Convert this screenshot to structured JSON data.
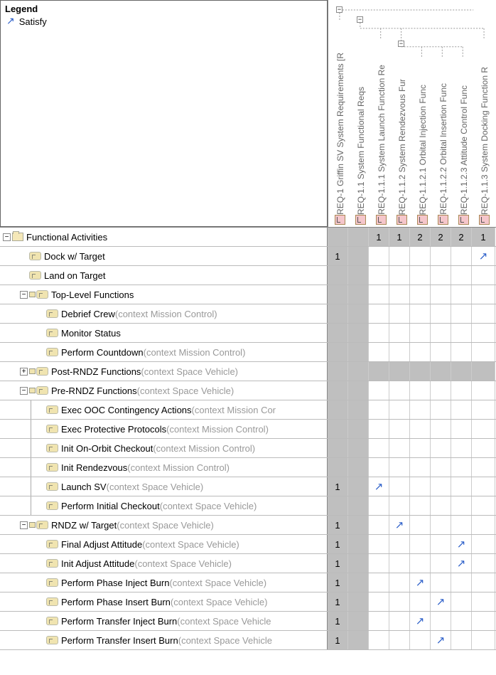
{
  "legend": {
    "title": "Legend",
    "items": [
      {
        "icon": "arrow-ne",
        "label": "Satisfy"
      }
    ]
  },
  "columns": [
    {
      "id": "REQ-1",
      "label": "REQ-1 Griffin SV System Requirements [R",
      "level": 0
    },
    {
      "id": "REQ-1.1",
      "label": "REQ-1.1 System Functional Reqs",
      "level": 1
    },
    {
      "id": "REQ-1.1.1",
      "label": "REQ-1.1.1 System Launch Function Re",
      "level": 2
    },
    {
      "id": "REQ-1.1.2",
      "label": "REQ-1.1.2 System Rendezvous Fur",
      "level": 2
    },
    {
      "id": "REQ-1.1.2.1",
      "label": "REQ-1.1.2.1 Orbital Injection Func",
      "level": 3
    },
    {
      "id": "REQ-1.1.2.2",
      "label": "REQ-1.1.2.2 Orbital Insertion Func",
      "level": 3
    },
    {
      "id": "REQ-1.1.2.3",
      "label": "REQ-1.1.2.3 Attitude Control Func",
      "level": 3
    },
    {
      "id": "REQ-1.1.3",
      "label": "REQ-1.1.3 System Docking Function R",
      "level": 2
    }
  ],
  "column_summary": [
    "",
    "",
    "1",
    "1",
    "2",
    "2",
    "2",
    "1"
  ],
  "rows": [
    {
      "type": "folder",
      "indent": 0,
      "toggle": "-",
      "label": "Functional Activities",
      "summary_row": true
    },
    {
      "type": "activity",
      "indent": 1,
      "label": "Dock w/ Target",
      "cells": {
        "0": "1",
        "7": "arrow"
      }
    },
    {
      "type": "activity",
      "indent": 1,
      "label": "Land on Target",
      "cells": {}
    },
    {
      "type": "activity",
      "indent": 1,
      "toggle": "-",
      "link": true,
      "label": "Top-Level Functions",
      "cells": {}
    },
    {
      "type": "activity",
      "indent": 2,
      "label": "Debrief Crew",
      "context": "(context Mission Control)",
      "cells": {}
    },
    {
      "type": "activity",
      "indent": 2,
      "label": "Monitor Status",
      "cells": {}
    },
    {
      "type": "activity",
      "indent": 2,
      "label": "Perform Countdown",
      "context": "(context Mission Control)",
      "cells": {}
    },
    {
      "type": "activity",
      "indent": 1,
      "toggle": "+",
      "link": true,
      "label": "Post-RNDZ Functions",
      "context": "(context Space Vehicle)",
      "all_grey": true
    },
    {
      "type": "activity",
      "indent": 1,
      "toggle": "-",
      "link": true,
      "label": "Pre-RNDZ Functions",
      "context": "(context Space Vehicle)",
      "cells": {}
    },
    {
      "type": "activity",
      "indent": 2,
      "vline_from": 1,
      "label": "Exec OOC Contingency Actions",
      "context": "(context Mission Cor",
      "cells": {}
    },
    {
      "type": "activity",
      "indent": 2,
      "vline_from": 1,
      "label": "Exec Protective Protocols",
      "context": "(context Mission Control)",
      "cells": {}
    },
    {
      "type": "activity",
      "indent": 2,
      "vline_from": 1,
      "label": "Init On-Orbit Checkout",
      "context": "(context Mission Control)",
      "cells": {}
    },
    {
      "type": "activity",
      "indent": 2,
      "vline_from": 1,
      "label": "Init Rendezvous",
      "context": "(context Mission Control)",
      "cells": {}
    },
    {
      "type": "activity",
      "indent": 2,
      "vline_from": 1,
      "label": "Launch SV",
      "context": "(context Space Vehicle)",
      "cells": {
        "0": "1",
        "2": "arrow"
      }
    },
    {
      "type": "activity",
      "indent": 2,
      "vline_from": 1,
      "last": true,
      "label": "Perform Initial Checkout",
      "context": "(context Space Vehicle)",
      "cells": {}
    },
    {
      "type": "activity",
      "indent": 1,
      "toggle": "-",
      "link": true,
      "label": "RNDZ w/ Target",
      "context": "(context Space Vehicle)",
      "cells": {
        "0": "1",
        "3": "arrow"
      }
    },
    {
      "type": "activity",
      "indent": 2,
      "label": "Final Adjust Attitude",
      "context": "(context Space Vehicle)",
      "cells": {
        "0": "1",
        "6": "arrow"
      }
    },
    {
      "type": "activity",
      "indent": 2,
      "label": "Init Adjust Attitude",
      "context": "(context Space Vehicle)",
      "cells": {
        "0": "1",
        "6": "arrow"
      }
    },
    {
      "type": "activity",
      "indent": 2,
      "label": "Perform Phase Inject Burn",
      "context": "(context Space Vehicle)",
      "cells": {
        "0": "1",
        "4": "arrow"
      }
    },
    {
      "type": "activity",
      "indent": 2,
      "label": "Perform Phase Insert Burn",
      "context": "(context Space Vehicle)",
      "cells": {
        "0": "1",
        "5": "arrow"
      }
    },
    {
      "type": "activity",
      "indent": 2,
      "label": "Perform Transfer Inject Burn",
      "context": "(context Space Vehicle",
      "cells": {
        "0": "1",
        "4": "arrow"
      }
    },
    {
      "type": "activity",
      "indent": 2,
      "label": "Perform Transfer Insert Burn",
      "context": "(context Space Vehicle",
      "cells": {
        "0": "1",
        "5": "arrow"
      }
    }
  ]
}
